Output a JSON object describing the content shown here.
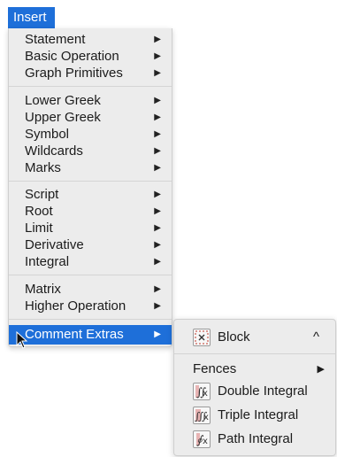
{
  "menubar": {
    "title": "Insert"
  },
  "menu": {
    "groups": [
      [
        "Statement",
        "Basic Operation",
        "Graph Primitives"
      ],
      [
        "Lower Greek",
        "Upper Greek",
        "Symbol",
        "Wildcards",
        "Marks"
      ],
      [
        "Script",
        "Root",
        "Limit",
        "Derivative",
        "Integral"
      ],
      [
        "Matrix",
        "Higher Operation"
      ],
      [
        "Comment Extras"
      ]
    ],
    "submenu_arrow": "▶",
    "highlighted": "Comment Extras",
    "highlight_color": "#1e6fd9"
  },
  "submenu": {
    "block": {
      "label": "Block",
      "shortcut": "^",
      "icon": "block-icon"
    },
    "fences": {
      "label": "Fences",
      "arrow": "▶"
    },
    "items": [
      {
        "label": "Double Integral",
        "icon": "double-integral-icon"
      },
      {
        "label": "Triple Integral",
        "icon": "triple-integral-icon"
      },
      {
        "label": "Path Integral",
        "icon": "path-integral-icon"
      }
    ]
  }
}
